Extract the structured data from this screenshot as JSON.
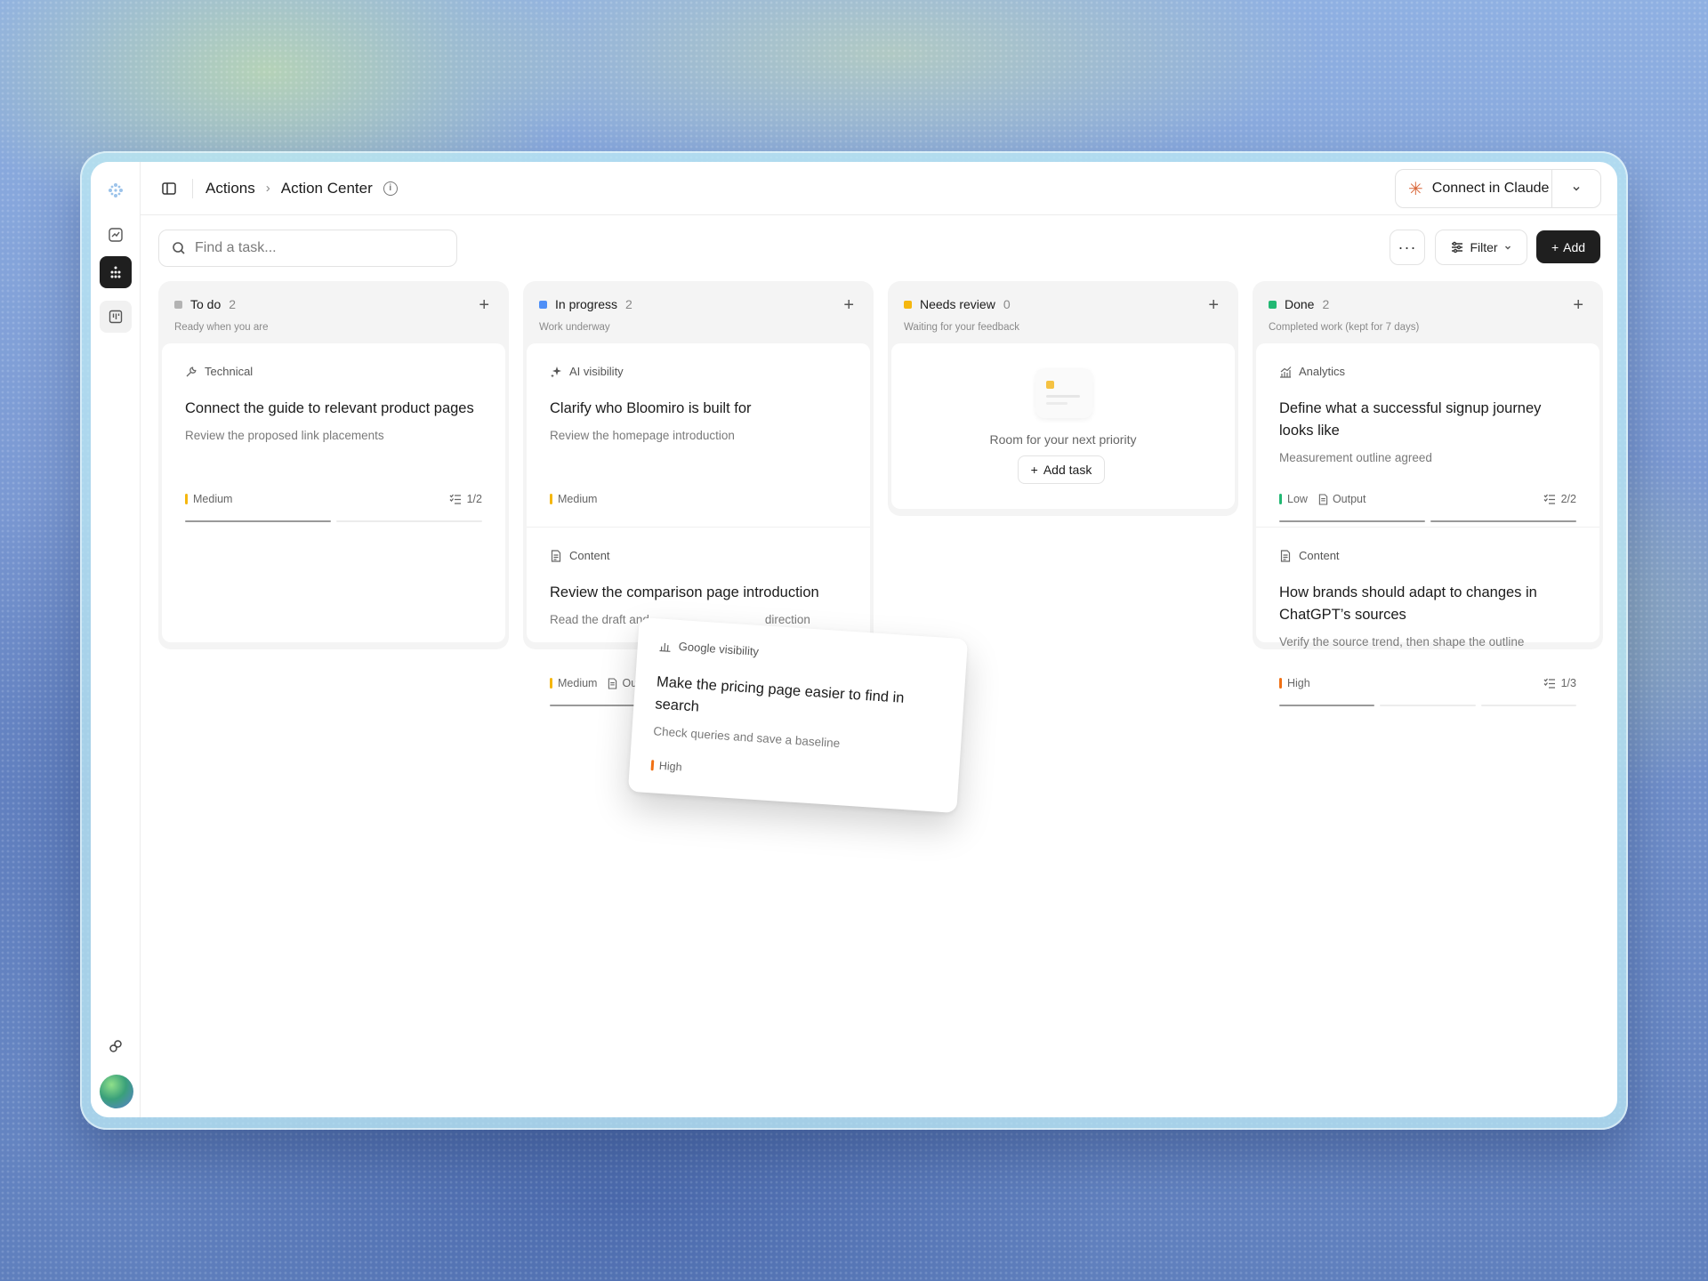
{
  "breadcrumb": {
    "parent": "Actions",
    "current": "Action Center"
  },
  "connect": {
    "label": "Connect in Claude"
  },
  "search": {
    "placeholder": "Find a task..."
  },
  "toolbar": {
    "more_label": "···",
    "filter_label": "Filter",
    "add_label": "Add"
  },
  "colors": {
    "todo": "#b3b3b3",
    "in_progress": "#4f8ff7",
    "needs_review": "#f5b70f",
    "done": "#22b873",
    "medium": "#f5b70f",
    "high": "#f07014",
    "low": "#22b873"
  },
  "columns": [
    {
      "name": "To do",
      "count": "2",
      "subtitle": "Ready when you are",
      "cards": [
        {
          "tag": "Technical",
          "icon": "wrench-icon",
          "title": "Connect the guide to relevant product pages",
          "desc": "Review the proposed link placements",
          "priority": "Medium",
          "subtasks": "1/2",
          "progress": 0.5
        }
      ]
    },
    {
      "name": "In progress",
      "count": "2",
      "subtitle": "Work underway",
      "cards": [
        {
          "tag": "AI visibility",
          "icon": "sparkle-icon",
          "title": "Clarify who Bloomiro is built for",
          "desc": "Review the homepage introduction",
          "priority": "Medium"
        },
        {
          "tag": "Content",
          "icon": "document-icon",
          "title": "Review the comparison page introduction",
          "desc": "Read the draft and",
          "desc_tail": "direction",
          "priority": "Medium",
          "output": "Ou"
        }
      ]
    },
    {
      "name": "Needs review",
      "count": "0",
      "subtitle": "Waiting for your feedback",
      "empty_text": "Room for your next priority",
      "empty_button": "Add task"
    },
    {
      "name": "Done",
      "count": "2",
      "subtitle": "Completed work (kept for 7 days)",
      "cards": [
        {
          "tag": "Analytics",
          "icon": "analytics-icon",
          "title": "Define what a successful signup journey looks like",
          "desc": "Measurement outline agreed",
          "priority": "Low",
          "output": "Output",
          "subtasks": "2/2",
          "progress": 1.0
        },
        {
          "tag": "Content",
          "icon": "document-icon",
          "title": "How brands should adapt to changes in ChatGPT’s sources",
          "desc": "Verify the source trend, then shape the outline",
          "priority": "High",
          "subtasks": "1/3",
          "progress": 0.33
        }
      ]
    }
  ],
  "dragged_card": {
    "tag": "Google visibility",
    "icon": "bar-chart-icon",
    "title": "Make the pricing page easier to find in search",
    "desc": "Check queries and save a baseline",
    "priority": "High"
  }
}
